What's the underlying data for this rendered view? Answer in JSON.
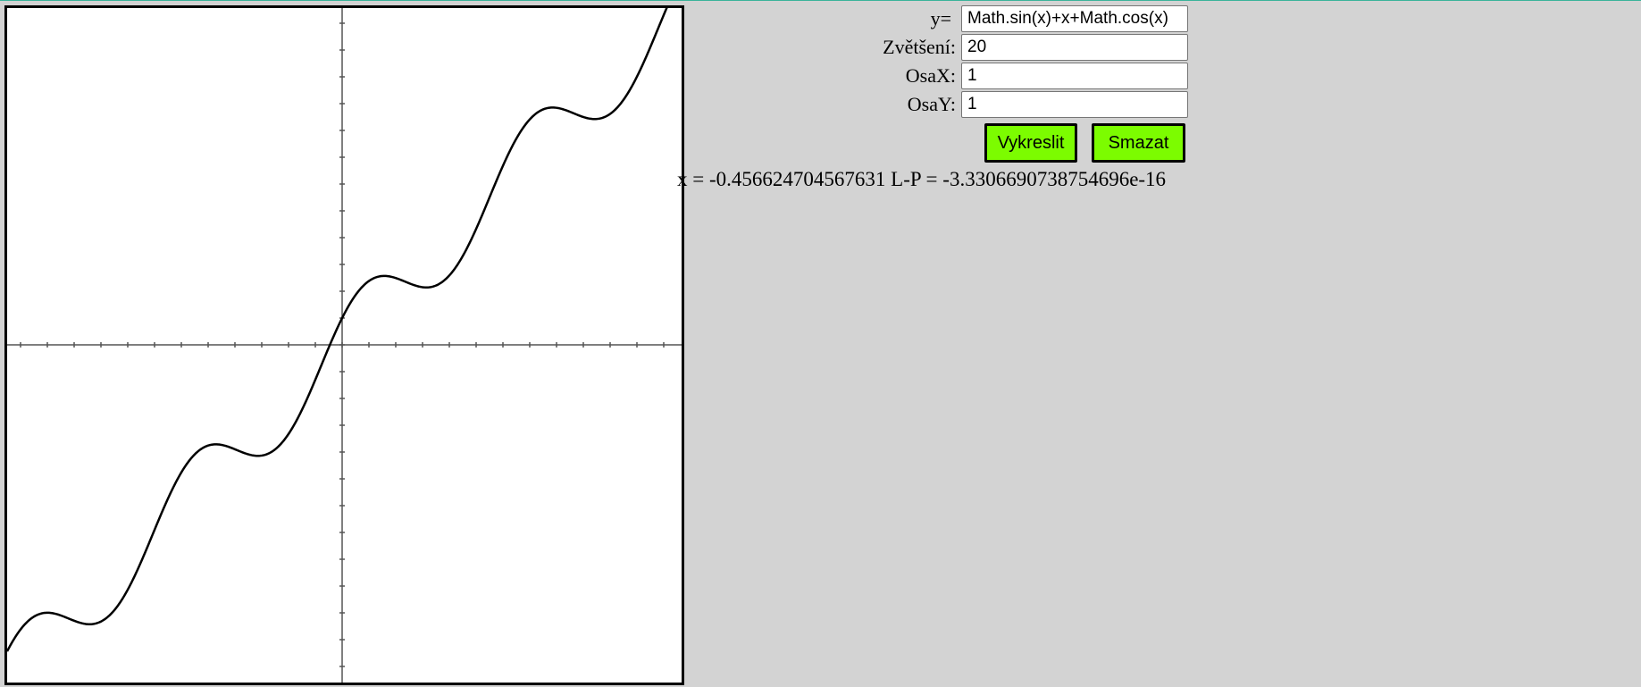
{
  "form": {
    "function_label": "y=",
    "function_value": "Math.sin(x)+x+Math.cos(x)",
    "zoom_label": "Zvětšení:",
    "zoom_value": "20",
    "axis_x_label": "OsaX:",
    "axis_x_value": "1",
    "axis_y_label": "OsaY:",
    "axis_y_value": "1"
  },
  "buttons": {
    "draw_label": "Vykreslit",
    "clear_label": "Smazat"
  },
  "result": {
    "x_label": "x =",
    "x_value": "-0.456624704567631",
    "lp_label": "L-P =",
    "lp_value": "-3.3306690738754696e-16"
  },
  "chart_data": {
    "type": "line",
    "expression": "Math.sin(x)+x+Math.cos(x)",
    "zoom": 20,
    "axis_x_step": 1,
    "axis_y_step": 1,
    "xlim": [
      -12.5,
      12.5
    ],
    "ylim": [
      -12.5,
      12.5
    ],
    "grid": false,
    "line_color": "#000000",
    "axis_color": "#555555"
  }
}
